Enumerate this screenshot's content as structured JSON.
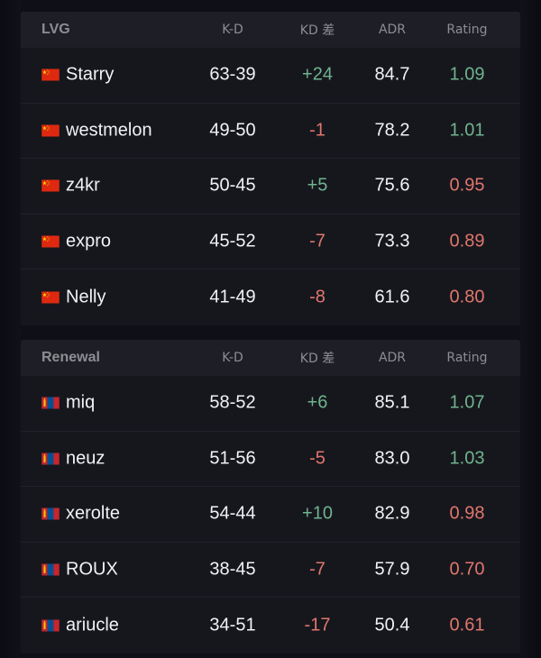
{
  "colors": {
    "background": "#0f1017",
    "panel": "#16171d",
    "header": "#1e1f26",
    "header_text": "#8d8d92",
    "text": "#f2f2f4",
    "positive": "#6fb38e",
    "negative": "#e0766d"
  },
  "columns": {
    "kd": "K-D",
    "diff": "KD 差",
    "adr": "ADR",
    "rating": "Rating"
  },
  "teams": [
    {
      "name": "LVG",
      "flag": "china-flag-icon",
      "players": [
        {
          "name": "Starry",
          "kd": "63-39",
          "diff": "+24",
          "adr": "84.7",
          "rating": "1.09",
          "diff_sign": "pos",
          "rating_sign": "pos"
        },
        {
          "name": "westmelon",
          "kd": "49-50",
          "diff": "-1",
          "adr": "78.2",
          "rating": "1.01",
          "diff_sign": "neg",
          "rating_sign": "pos"
        },
        {
          "name": "z4kr",
          "kd": "50-45",
          "diff": "+5",
          "adr": "75.6",
          "rating": "0.95",
          "diff_sign": "pos",
          "rating_sign": "neg"
        },
        {
          "name": "expro",
          "kd": "45-52",
          "diff": "-7",
          "adr": "73.3",
          "rating": "0.89",
          "diff_sign": "neg",
          "rating_sign": "neg"
        },
        {
          "name": "Nelly",
          "kd": "41-49",
          "diff": "-8",
          "adr": "61.6",
          "rating": "0.80",
          "diff_sign": "neg",
          "rating_sign": "neg"
        }
      ]
    },
    {
      "name": "Renewal",
      "flag": "mongolia-flag-icon",
      "players": [
        {
          "name": "miq",
          "kd": "58-52",
          "diff": "+6",
          "adr": "85.1",
          "rating": "1.07",
          "diff_sign": "pos",
          "rating_sign": "pos"
        },
        {
          "name": "neuz",
          "kd": "51-56",
          "diff": "-5",
          "adr": "83.0",
          "rating": "1.03",
          "diff_sign": "neg",
          "rating_sign": "pos"
        },
        {
          "name": "xerolte",
          "kd": "54-44",
          "diff": "+10",
          "adr": "82.9",
          "rating": "0.98",
          "diff_sign": "pos",
          "rating_sign": "neg"
        },
        {
          "name": "ROUX",
          "kd": "38-45",
          "diff": "-7",
          "adr": "57.9",
          "rating": "0.70",
          "diff_sign": "neg",
          "rating_sign": "neg"
        },
        {
          "name": "ariucle",
          "kd": "34-51",
          "diff": "-17",
          "adr": "50.4",
          "rating": "0.61",
          "diff_sign": "neg",
          "rating_sign": "neg"
        }
      ]
    }
  ]
}
